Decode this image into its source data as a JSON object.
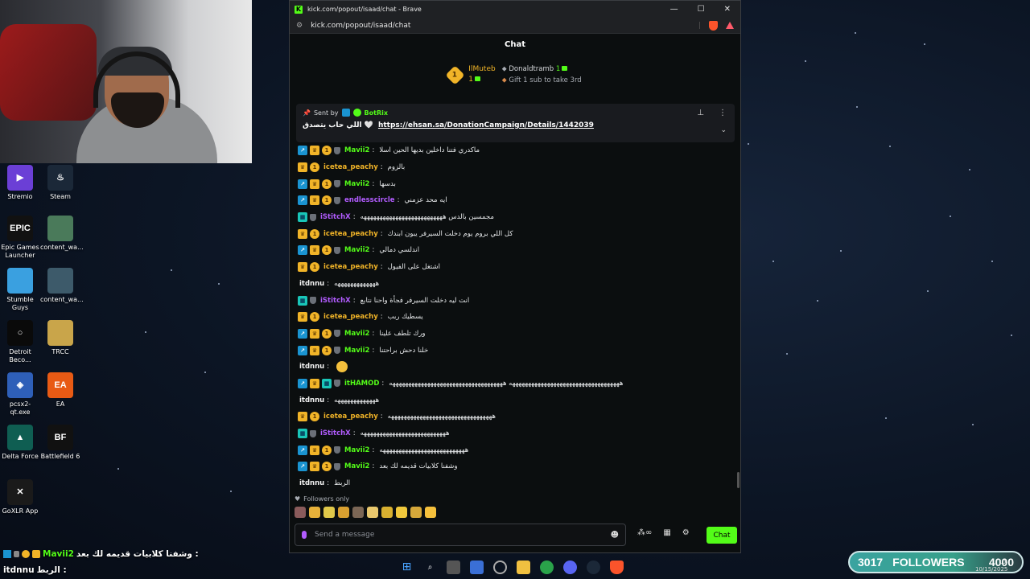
{
  "window": {
    "title": "kick.com/popout/isaad/chat - Brave",
    "url": "kick.com/popout/isaad/chat",
    "logo": "K"
  },
  "chat": {
    "header": "Chat",
    "leaderboard": {
      "rank": "1",
      "first_user": "IlMuteb",
      "first_count": "1",
      "second_user": "Donaldtramb",
      "second_count": "1",
      "gift_prompt": "Gift 1 sub to take 3rd"
    },
    "pinned": {
      "sent_by": "Sent by",
      "user": "BotRix",
      "text": "اللي حاب يتصدق 🤍",
      "link": "https://ehsan.sa/DonationCampaign/Details/1442039"
    },
    "messages": [
      {
        "user": "Mavii2",
        "text": "ماكدري فتنا داخلين بديها الحين اسلا",
        "color": "c-green",
        "badges": [
          "mod",
          "crown",
          "one",
          "sub"
        ]
      },
      {
        "user": "icetea_peachy",
        "text": "بالزوم",
        "color": "c-gold",
        "badges": [
          "crown",
          "one"
        ]
      },
      {
        "user": "Mavii2",
        "text": "بدسها",
        "color": "c-green",
        "badges": [
          "mod",
          "crown",
          "one",
          "sub"
        ]
      },
      {
        "user": "endlesscircle",
        "text": "ايه محد عزمني",
        "color": "c-purple",
        "badges": [
          "mod",
          "crown",
          "one",
          "sub"
        ]
      },
      {
        "user": "iStitchX",
        "text": "مجمسين بالدس ههههههههههههههههههههههههههه",
        "color": "c-purple",
        "badges": [
          "og",
          "sub"
        ]
      },
      {
        "user": "icetea_peachy",
        "text": "كل اللي بروم يوم دخلت السيرفر يبون ابندك",
        "color": "c-gold",
        "badges": [
          "crown",
          "one"
        ]
      },
      {
        "user": "Mavii2",
        "text": "اندلسي دمالي",
        "color": "c-green",
        "badges": [
          "mod",
          "crown",
          "one",
          "sub"
        ]
      },
      {
        "user": "icetea_peachy",
        "text": "اشتغل على الفيول",
        "color": "c-gold",
        "badges": [
          "crown",
          "one"
        ]
      },
      {
        "user": "itdnnu",
        "text": "هههههههههههههه",
        "color": "c-white",
        "badges": []
      },
      {
        "user": "iStitchX",
        "text": "انت ليه دخلت السيرفر فجأة واحنا نتابع",
        "color": "c-purple",
        "badges": [
          "og",
          "sub"
        ]
      },
      {
        "user": "icetea_peachy",
        "text": "يسطيك ربب",
        "color": "c-gold",
        "badges": [
          "crown",
          "one"
        ]
      },
      {
        "user": "Mavii2",
        "text": "ورك تلطف علينا",
        "color": "c-green",
        "badges": [
          "mod",
          "crown",
          "one",
          "sub"
        ]
      },
      {
        "user": "Mavii2",
        "text": "خلنا دحش براحتنا",
        "color": "c-green",
        "badges": [
          "mod",
          "crown",
          "one",
          "sub"
        ]
      },
      {
        "user": "itdnnu",
        "text": "",
        "color": "c-white",
        "badges": [],
        "emoji": true
      },
      {
        "user": "itHAMOD",
        "text": "هههههههههههههههههههههههههههههههههههه ههههههههههههههههههههههههههههههههههههه",
        "color": "c-green",
        "badges": [
          "mod",
          "crown",
          "og",
          "sub"
        ]
      },
      {
        "user": "itdnnu",
        "text": "هههههههههههههه",
        "color": "c-white",
        "badges": []
      },
      {
        "user": "icetea_peachy",
        "text": "هههههههههههههههههههههههههههههههههه",
        "color": "c-gold",
        "badges": [
          "crown",
          "one"
        ]
      },
      {
        "user": "iStitchX",
        "text": "هههههههههههههههههههههههههههه",
        "color": "c-purple",
        "badges": [
          "og",
          "sub"
        ]
      },
      {
        "user": "Mavii2",
        "text": "هههههههههههههههههههههههههههه",
        "color": "c-green",
        "badges": [
          "mod",
          "crown",
          "one",
          "sub"
        ]
      },
      {
        "user": "Mavii2",
        "text": "وشفنا كلابيات قديمه لك بعد",
        "color": "c-green",
        "badges": [
          "mod",
          "crown",
          "one",
          "sub"
        ]
      },
      {
        "user": "itdnnu",
        "text": "الربط",
        "color": "c-white",
        "badges": []
      }
    ],
    "followers_only": "Followers only",
    "input_placeholder": "Send a message",
    "send_label": "Chat"
  },
  "desktop_icons": [
    {
      "label": "Stremio",
      "color": "#6b3fd6",
      "glyph": "▶"
    },
    {
      "label": "Steam",
      "color": "#1b2838",
      "glyph": "♨"
    },
    {
      "label": "Epic Games Launcher",
      "color": "#111111",
      "glyph": "EPIC"
    },
    {
      "label": "content_wa...",
      "color": "#4a7a5a",
      "glyph": ""
    },
    {
      "label": "Stumble Guys",
      "color": "#3aa0e0",
      "glyph": ""
    },
    {
      "label": "content_wa...",
      "color": "#3d5a6a",
      "glyph": ""
    },
    {
      "label": "Detroit Beco...",
      "color": "#0a0a0a",
      "glyph": "○"
    },
    {
      "label": "TRCC",
      "color": "#c9a54a",
      "glyph": ""
    },
    {
      "label": "pcsx2-qt.exe",
      "color": "#2e5fb8",
      "glyph": "◈"
    },
    {
      "label": "EA",
      "color": "#e85a14",
      "glyph": "EA"
    },
    {
      "label": "Delta Force",
      "color": "#0f5e52",
      "glyph": "▲"
    },
    {
      "label": "Battlefield 6",
      "color": "#111111",
      "glyph": "BF"
    },
    {
      "label": "GoXLR App",
      "color": "#1a1a1a",
      "glyph": "✕"
    }
  ],
  "overlay_chat": [
    {
      "user": "Mavii2",
      "text": "وشفنا كلابيات قديمه لك بعد :"
    },
    {
      "user": "itdnnu",
      "text": "الربط :"
    }
  ],
  "follower_goal": {
    "current": "3017",
    "label": "FOLLOWERS",
    "target": "4000"
  },
  "clock": {
    "time": "10:",
    "date": "10/15/2025"
  },
  "colors": {
    "kick_green": "#53fc18",
    "gold": "#f1b428",
    "purple": "#b25cff"
  }
}
